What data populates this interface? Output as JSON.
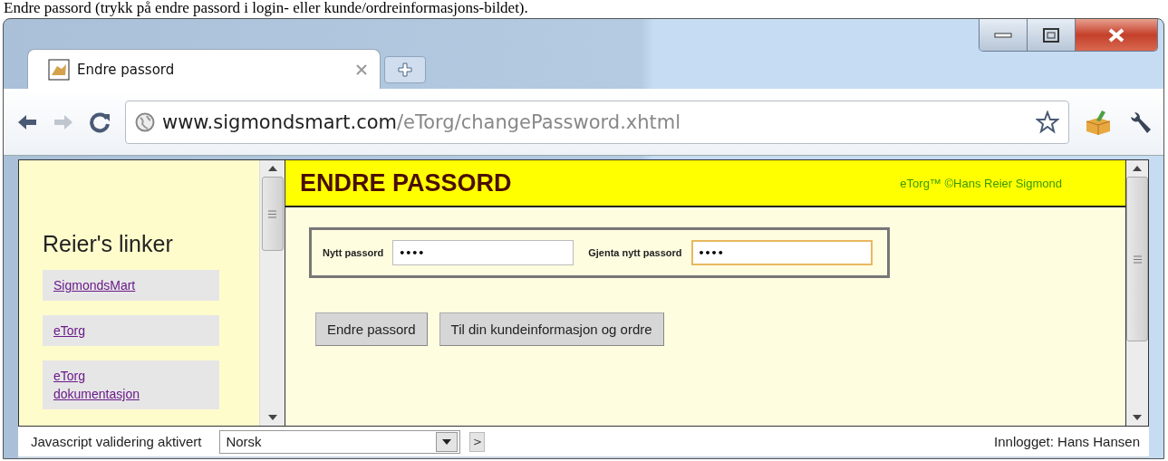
{
  "caption": "Endre passord (trykk på endre passord i login- eller kunde/ordreinformasjons-bildet).",
  "browser": {
    "tabs": [
      {
        "title": "Endre passord",
        "selected": true
      }
    ],
    "url": {
      "host": "www.sigmondsmart.com",
      "path": "/eTorg/changePassword.xhtml"
    }
  },
  "sidebar": {
    "title": "Reier's linker",
    "links": [
      {
        "label": "SigmondsMart",
        "visited": true
      },
      {
        "label": "eTorg",
        "visited": true
      },
      {
        "label": "eTorg dokumentasjon",
        "visited": true
      }
    ]
  },
  "page": {
    "title": "ENDRE PASSORD",
    "copyright": "eTorg™ ©Hans Reier Sigmond",
    "fields": [
      {
        "label": "Nytt passord",
        "value": "••••",
        "focused": false
      },
      {
        "label": "Gjenta nytt passord",
        "value": "••••",
        "focused": true
      }
    ],
    "buttons": [
      "Endre passord",
      "Til din kundeinformasjon og ordre"
    ]
  },
  "status_bar": {
    "validation": "Javascript validering aktivert",
    "language": "Norsk",
    "next": ">",
    "user": "Innlogget: Hans Hansen"
  }
}
